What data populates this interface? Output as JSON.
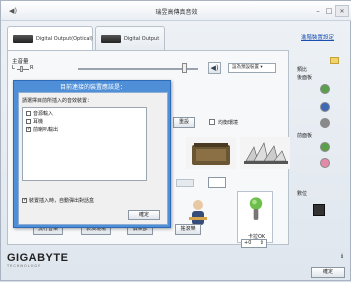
{
  "window": {
    "title": "瑞昱高傳真音效"
  },
  "tabs": [
    {
      "label": "Digital Output(Optical)"
    },
    {
      "label": "Digital Output"
    }
  ],
  "advanced_link": "進階裝置設定",
  "volume": {
    "label": "主音量",
    "left": "L",
    "right": "R",
    "default_device": "設為預設裝置"
  },
  "effects": {
    "reset": "重設",
    "environment_label": "均衡環境"
  },
  "karaoke": {
    "label": "卡拉OK",
    "value": "+0"
  },
  "bottom_buttons": [
    "流行音樂",
    "表演現場",
    "俱樂部",
    "搖滾樂"
  ],
  "sidebar": {
    "analog_label": "類比",
    "back_panel": "後面板",
    "front_panel": "前面板",
    "digital_label": "數位"
  },
  "footer": {
    "logo": "GIGABYTE",
    "logo_sub": "TECHNOLOGY",
    "ok": "確定"
  },
  "dialog": {
    "title": "目前連接的裝置應該是：",
    "prompt": "請選擇目前所插入的音效裝置：",
    "items": [
      {
        "label": "音源輸入",
        "checked": false
      },
      {
        "label": "耳機",
        "checked": false
      },
      {
        "label": "前喇叭輸出",
        "checked": true
      }
    ],
    "auto_popup": "裝置插入時，自動彈出對話盒",
    "auto_popup_checked": true,
    "ok": "確定"
  }
}
